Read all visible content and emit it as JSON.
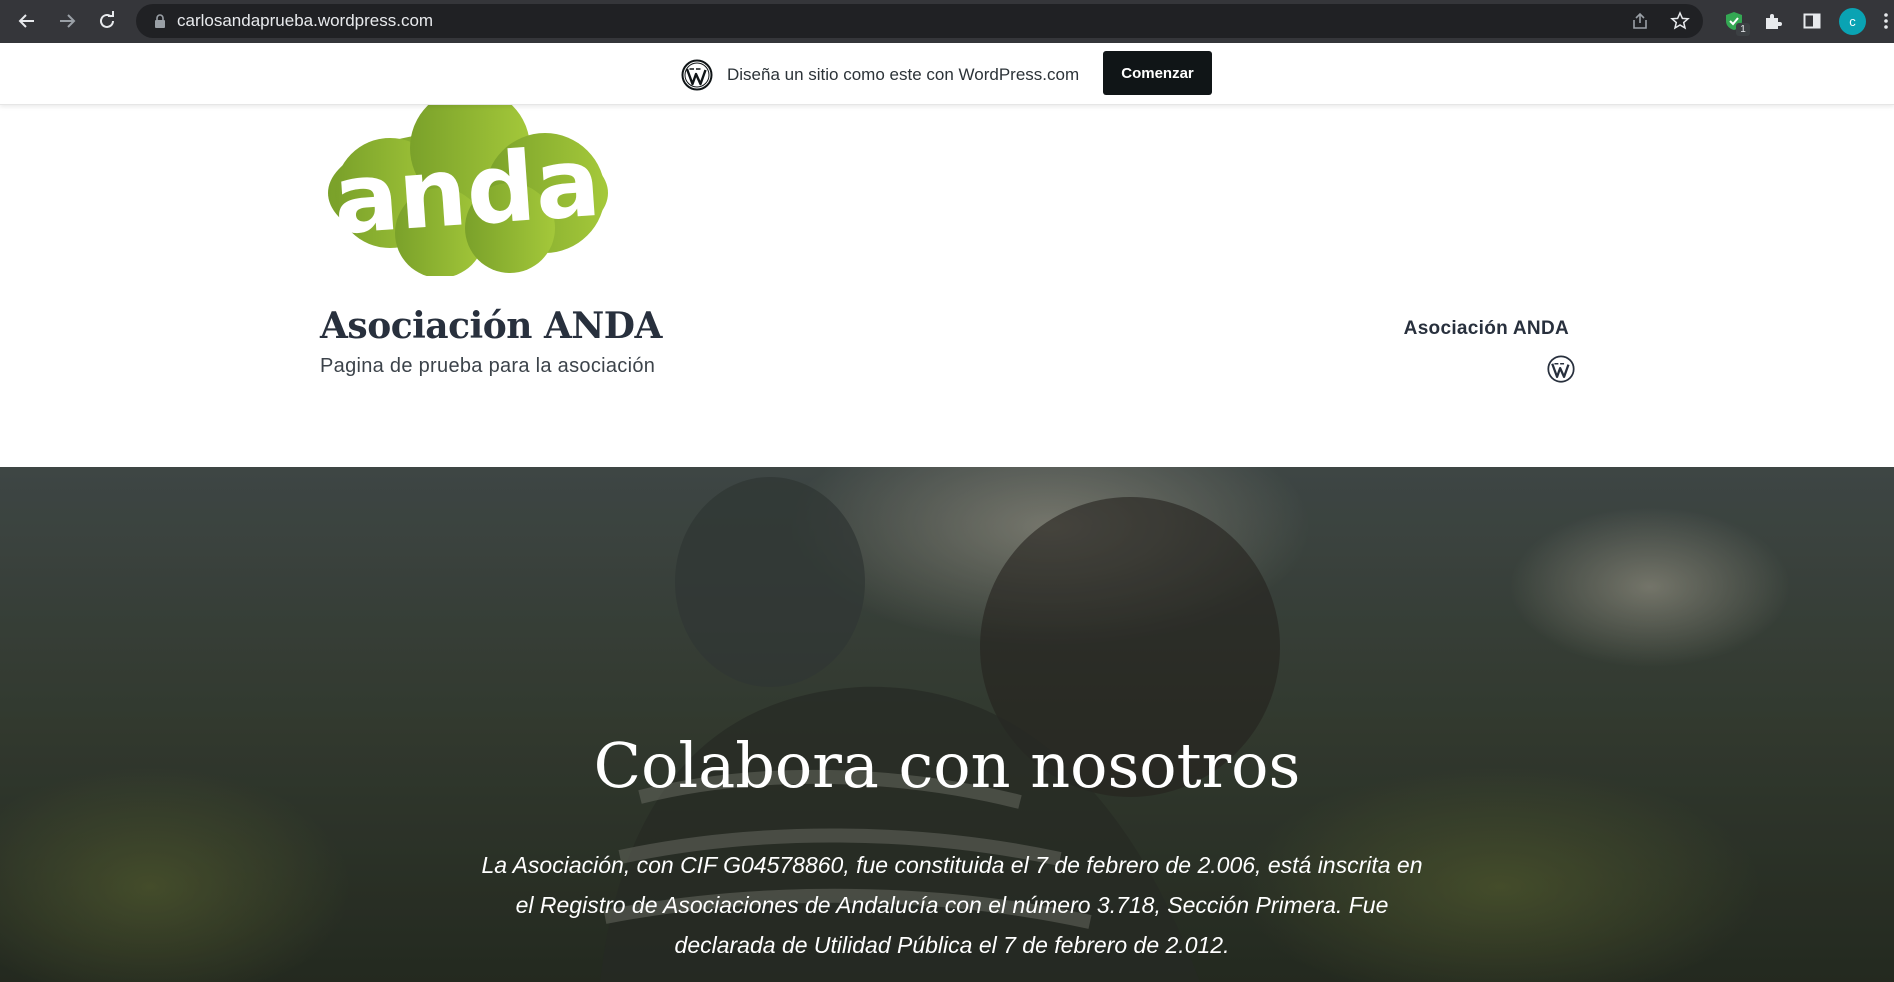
{
  "browser": {
    "url": "carlosandaprueba.wordpress.com",
    "extension_badge": "1",
    "profile_initial": "c"
  },
  "wp_banner": {
    "text": "Diseña un sitio como este con WordPress.com",
    "button": "Comenzar"
  },
  "site": {
    "logo_text": "anda",
    "title": "Asociación ANDA",
    "tagline": "Pagina de prueba para la asociación"
  },
  "menu": {
    "item": "Asociación ANDA"
  },
  "hero": {
    "title": "Colabora con nosotros",
    "text": "La Asociación, con CIF G04578860, fue constituida el 7 de febrero de 2.006, está inscrita en el Registro de Asociaciones de Andalucía con el número 3.718, Sección Primera. Fue declarada de Utilidad Pública el 7 de febrero de 2.012."
  },
  "colors": {
    "chrome_bg": "#35363a",
    "omnibox_bg": "#202124",
    "logo_green": "#8bb52a",
    "title_color": "#28303d",
    "button_bg": "#101517"
  }
}
